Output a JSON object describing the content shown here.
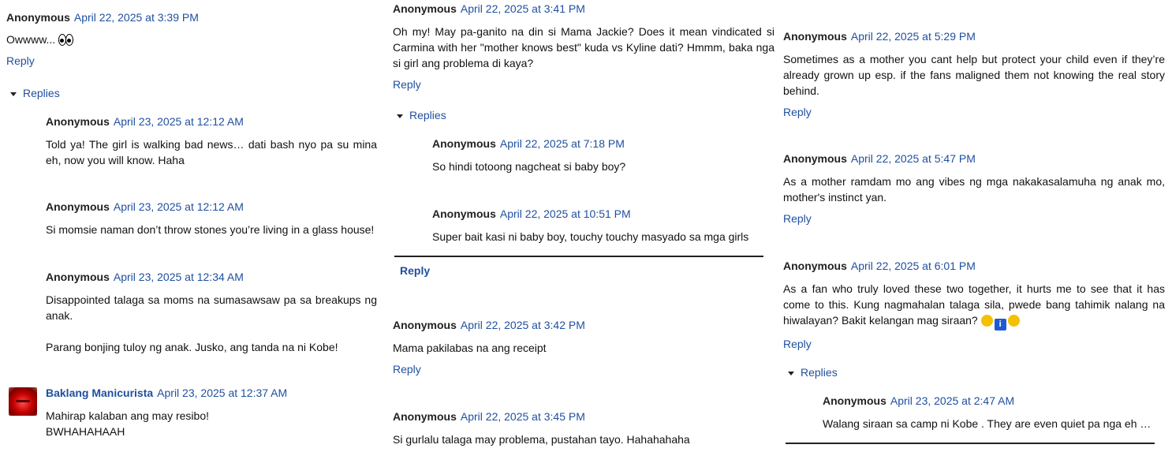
{
  "col1": {
    "c1": {
      "author": "Anonymous",
      "date": "April 22, 2025 at 3:39 PM",
      "text": "Owwww... ",
      "reply": "Reply"
    },
    "replies_label": "Replies",
    "r1": {
      "author": "Anonymous",
      "date": "April 23, 2025 at 12:12 AM",
      "text": "Told ya! The girl is walking bad news… dati bash nyo pa su mina eh, now you will know. Haha"
    },
    "r2": {
      "author": "Anonymous",
      "date": "April 23, 2025 at 12:12 AM",
      "text": "Si momsie naman don’t throw stones you’re living in a glass house!"
    },
    "r3": {
      "author": "Anonymous",
      "date": "April 23, 2025 at 12:34 AM",
      "text1": "Disappointed talaga sa moms na sumasawsaw pa sa breakups ng anak.",
      "text2": "Parang bonjing tuloy ng anak. Jusko, ang tanda na ni Kobe!"
    },
    "r4": {
      "author": "Baklang Manicurista",
      "date": "April 23, 2025 at 12:37 AM",
      "text1": "Mahirap kalaban ang may resibo!",
      "text2": "BWHAHAHAAH"
    }
  },
  "col2": {
    "c1": {
      "author": "Anonymous",
      "date": "April 22, 2025 at 3:41 PM",
      "text": "Oh my! May pa-ganito na din si Mama Jackie? Does it mean vindicated si Carmina with her \"mother knows best\" kuda vs Kyline dati? Hmmm, baka nga si girl ang problema di kaya?",
      "reply": "Reply"
    },
    "replies_label": "Replies",
    "r1": {
      "author": "Anonymous",
      "date": "April 22, 2025 at 7:18 PM",
      "text": "So hindi totoong nagcheat si baby boy?"
    },
    "r2": {
      "author": "Anonymous",
      "date": "April 22, 2025 at 10:51 PM",
      "text": "Super bait kasi ni baby boy, touchy touchy masyado sa mga girls"
    },
    "reply_bold": "Reply",
    "c2": {
      "author": "Anonymous",
      "date": "April 22, 2025 at 3:42 PM",
      "text": "Mama pakilabas na ang receipt",
      "reply": "Reply"
    },
    "c3": {
      "author": "Anonymous",
      "date": "April 22, 2025 at 3:45 PM",
      "text": "Si gurlalu talaga may problema, pustahan tayo. Hahahahaha"
    }
  },
  "col3": {
    "c1": {
      "author": "Anonymous",
      "date": "April 22, 2025 at 5:29 PM",
      "text": "Sometimes as a mother you cant help but protect your child even if they’re already grown up esp. if the fans maligned them not knowing the real story behind.",
      "reply": "Reply"
    },
    "c2": {
      "author": "Anonymous",
      "date": "April 22, 2025 at 5:47 PM",
      "text": "As a mother ramdam mo ang vibes ng mga nakakasalamuha ng anak mo, mother's instinct yan.",
      "reply": "Reply"
    },
    "c3": {
      "author": "Anonymous",
      "date": "April 22, 2025 at 6:01 PM",
      "text": "As a fan who truly loved these two together, it hurts me to see that it has come to this. Kung nagmahalan talaga sila, pwede bang tahimik nalang na hiwalayan? Bakit kelangan mag siraan? ",
      "reply": "Reply"
    },
    "replies_label": "Replies",
    "r1": {
      "author": "Anonymous",
      "date": "April 23, 2025 at 2:47 AM",
      "text": "Walang siraan sa camp ni Kobe . They are even quiet pa nga eh …"
    }
  }
}
